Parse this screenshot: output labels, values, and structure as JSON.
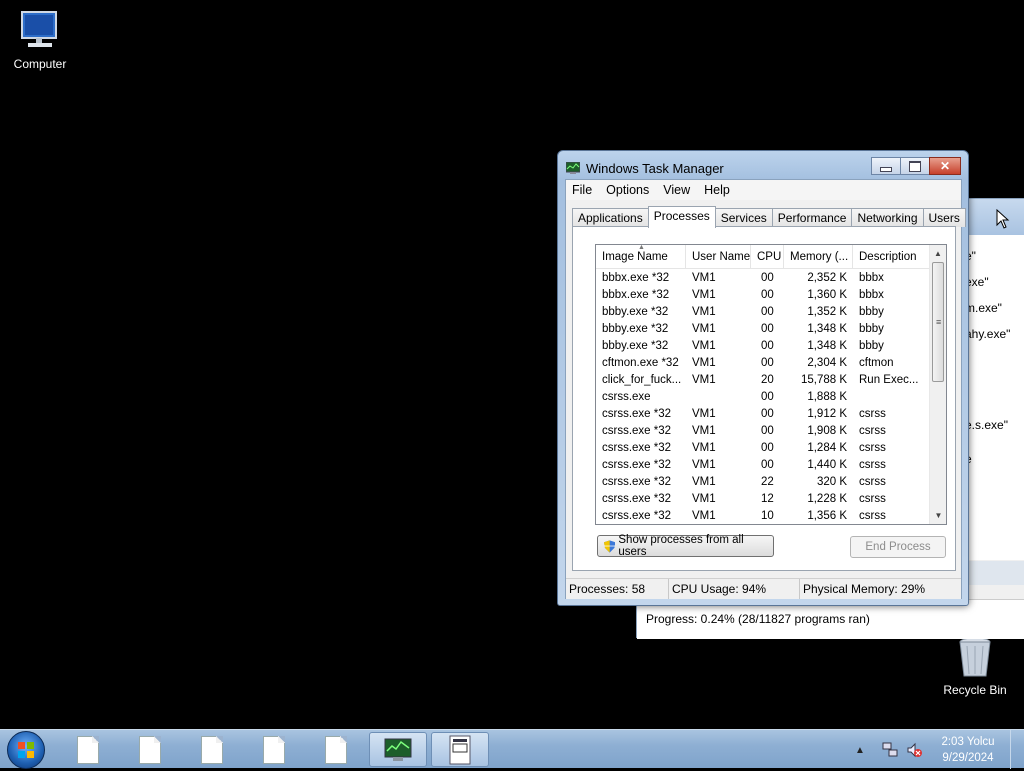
{
  "desktop": {
    "icons": [
      {
        "label": "Computer"
      },
      {
        "label": "Recycle Bin"
      }
    ]
  },
  "background_window": {
    "fragments": [
      "e\"",
      "exe\"",
      "m.exe\"",
      "ahy.exe\"",
      "e.s.exe\"",
      "e"
    ],
    "progress": "Progress: 0.24% (28/11827 programs ran)"
  },
  "task_manager": {
    "title": "Windows Task Manager",
    "menu": [
      "File",
      "Options",
      "View",
      "Help"
    ],
    "tabs": [
      "Applications",
      "Processes",
      "Services",
      "Performance",
      "Networking",
      "Users"
    ],
    "active_tab": "Processes",
    "columns": [
      "Image Name",
      "User Name",
      "CPU",
      "Memory (...",
      "Description"
    ],
    "rows": [
      [
        "bbbx.exe *32",
        "VM1",
        "00",
        "2,352 K",
        "bbbx"
      ],
      [
        "bbbx.exe *32",
        "VM1",
        "00",
        "1,360 K",
        "bbbx"
      ],
      [
        "bbby.exe *32",
        "VM1",
        "00",
        "1,352 K",
        "bbby"
      ],
      [
        "bbby.exe *32",
        "VM1",
        "00",
        "1,348 K",
        "bbby"
      ],
      [
        "bbby.exe *32",
        "VM1",
        "00",
        "1,348 K",
        "bbby"
      ],
      [
        "cftmon.exe *32",
        "VM1",
        "00",
        "2,304 K",
        "cftmon"
      ],
      [
        "click_for_fuck...",
        "VM1",
        "20",
        "15,788 K",
        "Run Exec..."
      ],
      [
        "csrss.exe",
        "",
        "00",
        "1,888 K",
        ""
      ],
      [
        "csrss.exe *32",
        "VM1",
        "00",
        "1,912 K",
        "csrss"
      ],
      [
        "csrss.exe *32",
        "VM1",
        "00",
        "1,908 K",
        "csrss"
      ],
      [
        "csrss.exe *32",
        "VM1",
        "00",
        "1,284 K",
        "csrss"
      ],
      [
        "csrss.exe *32",
        "VM1",
        "00",
        "1,440 K",
        "csrss"
      ],
      [
        "csrss.exe *32",
        "VM1",
        "22",
        "320 K",
        "csrss"
      ],
      [
        "csrss.exe *32",
        "VM1",
        "12",
        "1,228 K",
        "csrss"
      ],
      [
        "csrss.exe *32",
        "VM1",
        "10",
        "1,356 K",
        "csrss"
      ]
    ],
    "show_all_button": "Show processes from all users",
    "end_process_button": "End Process",
    "status": {
      "processes": "Processes: 58",
      "cpu": "CPU Usage: 94%",
      "memory": "Physical Memory: 29%"
    }
  },
  "taskbar": {
    "clock_time": "2:03 Yolcu",
    "clock_date": "9/29/2024"
  }
}
